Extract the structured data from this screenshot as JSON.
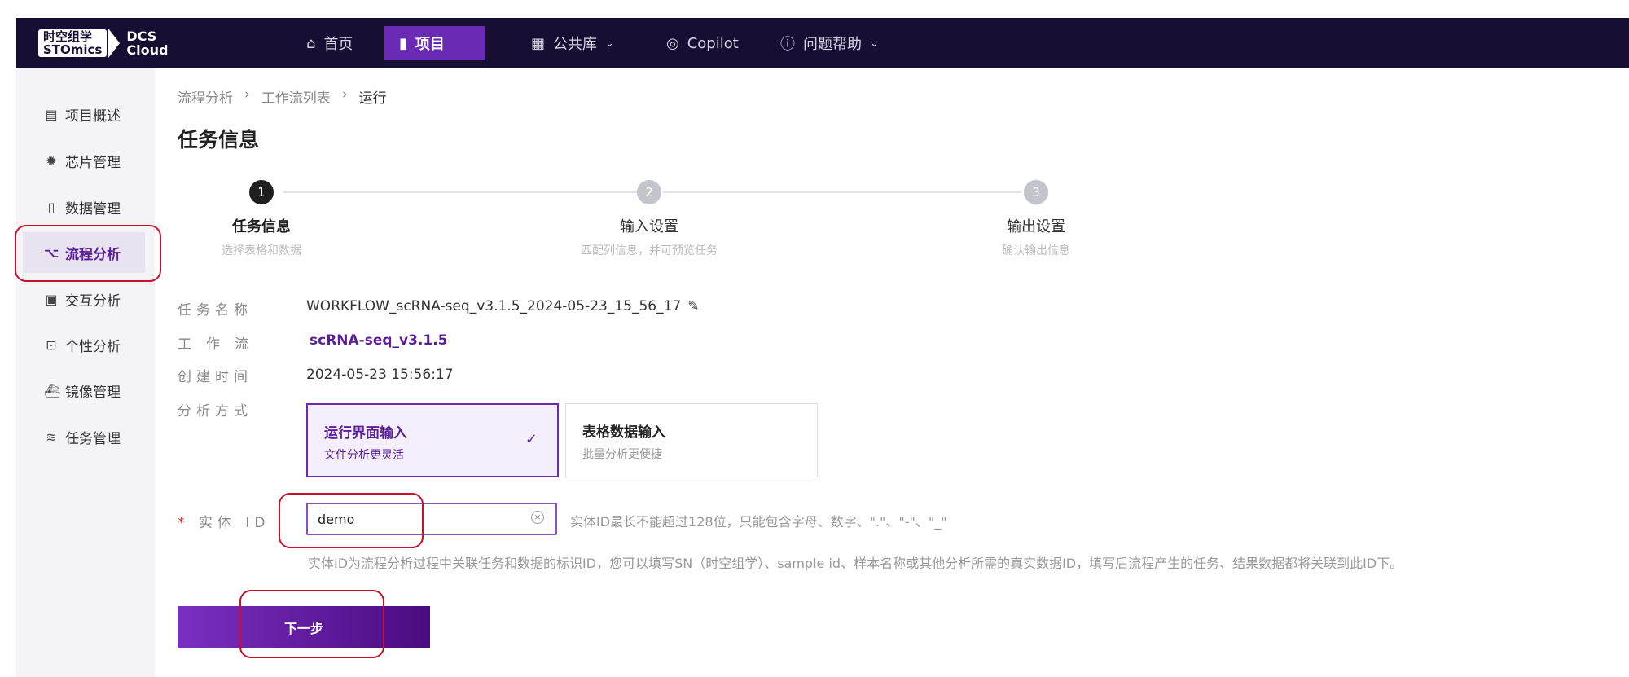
{
  "logo": {
    "line1": "时空组学",
    "line2": "STOmics",
    "product1": "DCS",
    "product2": "Cloud"
  },
  "nav": [
    {
      "label": "首页",
      "icon": "home-icon"
    },
    {
      "label": "项目",
      "icon": "document-icon",
      "active": true
    },
    {
      "label": "公共库",
      "icon": "grid-icon",
      "dropdown": true
    },
    {
      "label": "Copilot",
      "icon": "copilot-icon"
    },
    {
      "label": "问题帮助",
      "icon": "help-icon",
      "dropdown": true
    }
  ],
  "sidebar": {
    "items": [
      {
        "label": "项目概述",
        "icon": "file-icon"
      },
      {
        "label": "芯片管理",
        "icon": "chip-icon"
      },
      {
        "label": "数据管理",
        "icon": "data-file-icon"
      },
      {
        "label": "流程分析",
        "icon": "workflow-icon",
        "active": true
      },
      {
        "label": "交互分析",
        "icon": "image-icon"
      },
      {
        "label": "个性分析",
        "icon": "code-icon"
      },
      {
        "label": "镜像管理",
        "icon": "docker-icon"
      },
      {
        "label": "任务管理",
        "icon": "layers-icon"
      }
    ]
  },
  "breadcrumb": [
    "流程分析",
    "工作流列表",
    "运行"
  ],
  "page_title": "任务信息",
  "steps": [
    {
      "num": "1",
      "title": "任务信息",
      "sub": "选择表格和数据",
      "active": true
    },
    {
      "num": "2",
      "title": "输入设置",
      "sub": "匹配列信息，并可预览任务"
    },
    {
      "num": "3",
      "title": "输出设置",
      "sub": "确认输出信息"
    }
  ],
  "form": {
    "task_name_label": "任务名称",
    "task_name": "WORKFLOW_scRNA-seq_v3.1.5_2024-05-23_15_56_17",
    "workflow_label": "工作流",
    "workflow": "scRNA-seq_v3.1.5",
    "created_label": "创建时间",
    "created": "2024-05-23 15:56:17",
    "mode_label": "分析方式",
    "modes": [
      {
        "title": "运行界面输入",
        "sub": "文件分析更灵活",
        "selected": true
      },
      {
        "title": "表格数据输入",
        "sub": "批量分析更便捷"
      }
    ],
    "entity_required": "*",
    "entity_label": "实体 ID",
    "entity_value": "demo",
    "entity_hint": "实体ID最长不能超过128位，只能包含字母、数字、\".\"、\"-\"、\"_\"",
    "entity_desc": "实体ID为流程分析过程中关联任务和数据的标识ID，您可以填写SN（时空组学）、sample id、样本名称或其他分析所需的真实数据ID，填写后流程产生的任务、结果数据都将关联到此ID下。"
  },
  "next_button": "下一步",
  "colors": {
    "brand": "#6a2ab3",
    "topbar": "#170f33",
    "annotation": "#c8102e"
  }
}
